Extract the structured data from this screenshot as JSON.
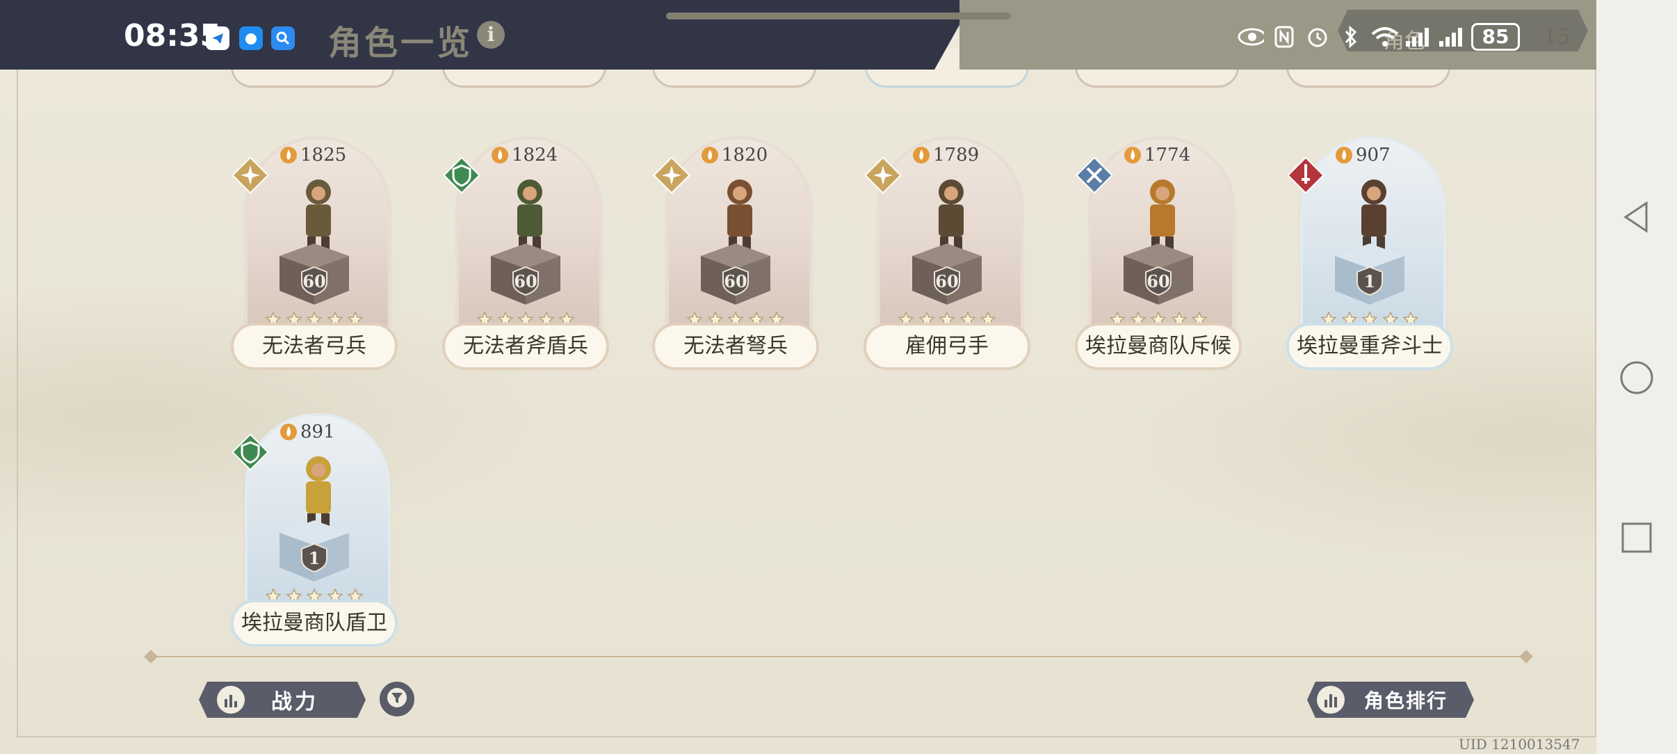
{
  "status_bar": {
    "time": "08:35",
    "battery": "85",
    "ghost_battery": "15",
    "ghost_tab_label": "角色",
    "icons": [
      "telegram-like-app-icon",
      "bubble-app-icon",
      "search-app-icon",
      "eye-icon",
      "nfc-icon",
      "alarm-icon",
      "bluetooth-icon",
      "wifi-icon",
      "signal-icon",
      "signal-icon"
    ]
  },
  "header": {
    "title": "角色一览",
    "info_icon": "i"
  },
  "cards": [
    {
      "name": "无法者弓兵",
      "power": "1825",
      "level": "60",
      "stars": 5,
      "role": "wind-star",
      "tier": "brown"
    },
    {
      "name": "无法者斧盾兵",
      "power": "1824",
      "level": "60",
      "stars": 5,
      "role": "shield",
      "tier": "brown"
    },
    {
      "name": "无法者弩兵",
      "power": "1820",
      "level": "60",
      "stars": 5,
      "role": "wind-star",
      "tier": "brown"
    },
    {
      "name": "雇佣弓手",
      "power": "1789",
      "level": "60",
      "stars": 5,
      "role": "wind-star",
      "tier": "brown"
    },
    {
      "name": "埃拉曼商队斥候",
      "power": "1774",
      "level": "60",
      "stars": 5,
      "role": "swords",
      "tier": "brown"
    },
    {
      "name": "埃拉曼重斧斗士",
      "power": "907",
      "level": "1",
      "stars": 5,
      "role": "sword",
      "tier": "blue"
    },
    {
      "name": "埃拉曼商队盾卫",
      "power": "891",
      "level": "1",
      "stars": 5,
      "role": "shield",
      "tier": "blue"
    }
  ],
  "footer": {
    "sort_label": "战力",
    "rank_label": "角色排行",
    "uid": "UID 1210013547"
  },
  "colors": {
    "background": "#e9e5d6",
    "status_dark": "#313546",
    "button": "#5a5d69",
    "role_gold": "#c9a45f",
    "role_green": "#3f8a52",
    "role_blue": "#5a7ea6",
    "role_red": "#b4363d"
  }
}
